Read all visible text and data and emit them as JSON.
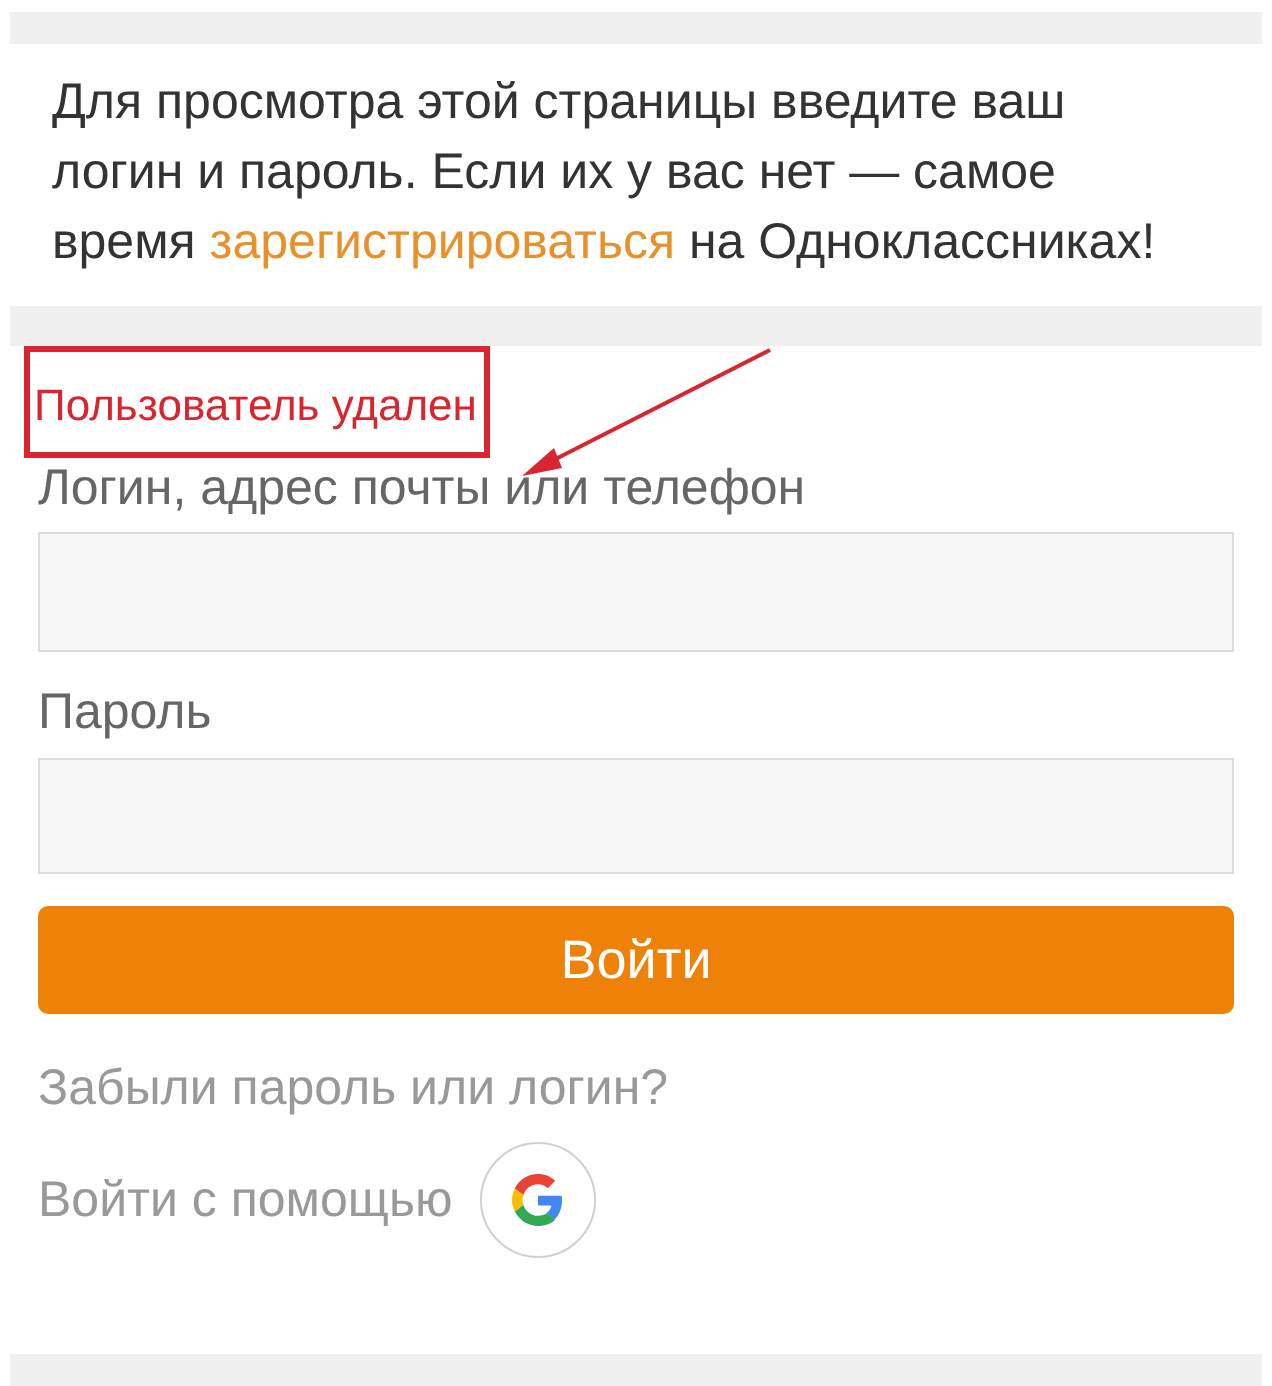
{
  "intro": {
    "text": "Для просмотра этой страницы введите ваш логин и пароль. Если их у вас нет — самое время ",
    "link": "зарегистрироваться",
    "after": " на Одноклассниках!"
  },
  "error": "Пользователь удален",
  "fields": [
    {
      "label": "Логин, адрес почты или телефон"
    },
    {
      "label": "Пароль"
    }
  ],
  "submit": "Войти",
  "forgot": "Забыли пароль или логин?",
  "social_label": "Войти с помощью"
}
